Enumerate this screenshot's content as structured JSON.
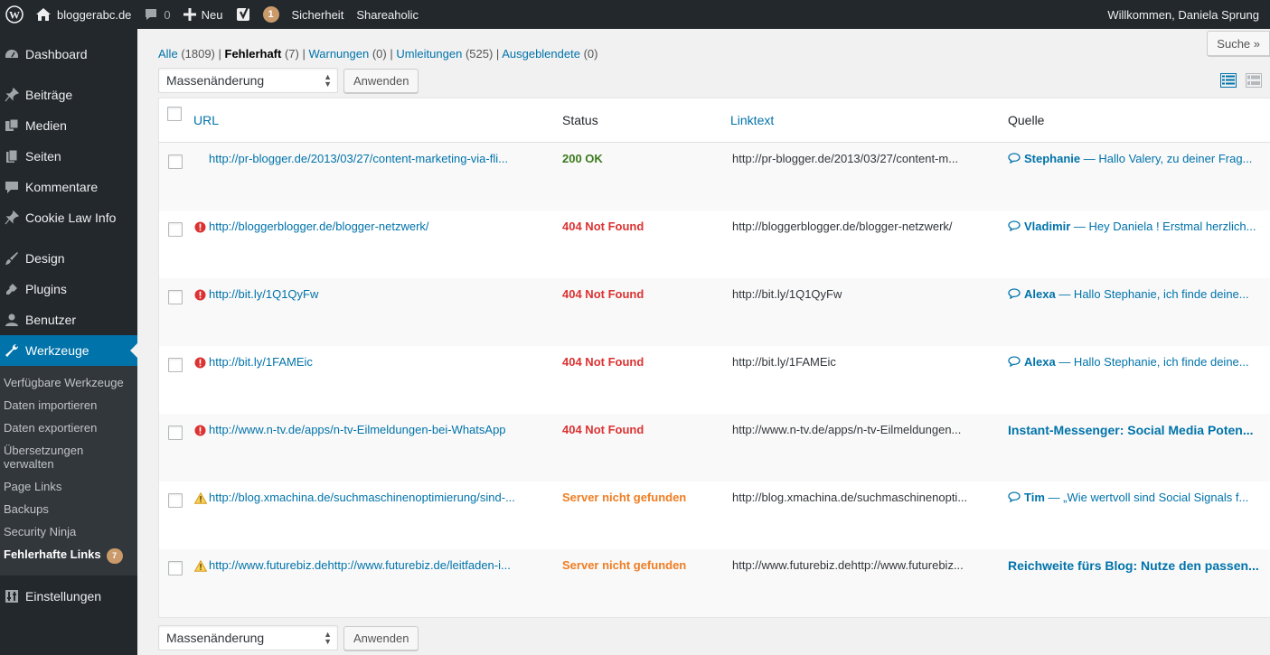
{
  "adminbar": {
    "site_name": "bloggerabc.de",
    "comments_count": "0",
    "new_label": "Neu",
    "yoast_count": "1",
    "security_label": "Sicherheit",
    "shareaholic_label": "Shareaholic",
    "welcome": "Willkommen, Daniela Sprung"
  },
  "sidebar": {
    "items": [
      {
        "label": "Dashboard",
        "icon": "dashboard-icon"
      },
      {
        "label": "Beiträge",
        "icon": "pin-icon"
      },
      {
        "label": "Medien",
        "icon": "media-icon"
      },
      {
        "label": "Seiten",
        "icon": "pages-icon"
      },
      {
        "label": "Kommentare",
        "icon": "comment-icon"
      },
      {
        "label": "Cookie Law Info",
        "icon": "pin-icon"
      },
      {
        "label": "Design",
        "icon": "brush-icon"
      },
      {
        "label": "Plugins",
        "icon": "plugin-icon"
      },
      {
        "label": "Benutzer",
        "icon": "user-icon"
      },
      {
        "label": "Werkzeuge",
        "icon": "wrench-icon"
      },
      {
        "label": "Einstellungen",
        "icon": "settings-icon"
      }
    ],
    "submenu": [
      "Verfügbare Werkzeuge",
      "Daten importieren",
      "Daten exportieren",
      "Übersetzungen verwalten",
      "Page Links",
      "Backups",
      "Security Ninja",
      "Fehlerhafte Links"
    ],
    "submenu_badge": "7"
  },
  "main": {
    "search_button": "Suche »",
    "filters": {
      "all_label": "Alle",
      "all_count": "(1809)",
      "broken_label": "Fehlerhaft",
      "broken_count": "(7)",
      "warnings_label": "Warnungen",
      "warnings_count": "(0)",
      "redirects_label": "Umleitungen",
      "redirects_count": "(525)",
      "hidden_label": "Ausgeblendete",
      "hidden_count": "(0)"
    },
    "bulk_select": "Massenänderung",
    "apply_button": "Anwenden",
    "columns": {
      "url": "URL",
      "status": "Status",
      "linktext": "Linktext",
      "source": "Quelle"
    },
    "rows": [
      {
        "url": "http://pr-blogger.de/2013/03/27/content-marketing-via-fli...",
        "status": "200 OK",
        "status_type": "ok",
        "linktext": "http://pr-blogger.de/2013/03/27/content-m...",
        "source_author": "Stephanie",
        "source_text": " — Hallo Valery, zu deiner Frag...",
        "source_type": "comment"
      },
      {
        "url": "http://bloggerblogger.de/blogger-netzwerk/",
        "status": "404 Not Found",
        "status_type": "error",
        "linktext": "http://bloggerblogger.de/blogger-netzwerk/",
        "source_author": "Vladimir",
        "source_text": " — Hey Daniela ! Erstmal herzlich...",
        "source_type": "comment"
      },
      {
        "url": "http://bit.ly/1Q1QyFw",
        "status": "404 Not Found",
        "status_type": "error",
        "linktext": "http://bit.ly/1Q1QyFw",
        "source_author": "Alexa",
        "source_text": " — Hallo Stephanie, ich finde deine...",
        "source_type": "comment"
      },
      {
        "url": "http://bit.ly/1FAMEic",
        "status": "404 Not Found",
        "status_type": "error",
        "linktext": "http://bit.ly/1FAMEic",
        "source_author": "Alexa",
        "source_text": " — Hallo Stephanie, ich finde deine...",
        "source_type": "comment"
      },
      {
        "url": "http://www.n-tv.de/apps/n-tv-Eilmeldungen-bei-WhatsApp",
        "status": "404 Not Found",
        "status_type": "error",
        "linktext": "http://www.n-tv.de/apps/n-tv-Eilmeldungen...",
        "source_author": "",
        "source_text": "Instant-Messenger: Social Media Poten...",
        "source_type": "post"
      },
      {
        "url": "http://blog.xmachina.de/suchmaschinenoptimierung/sind-...",
        "status": "Server nicht gefunden",
        "status_type": "warn",
        "linktext": "http://blog.xmachina.de/suchmaschinenopti...",
        "source_author": "Tim",
        "source_text": " — „Wie wertvoll sind Social Signals f...",
        "source_type": "comment"
      },
      {
        "url": "http://www.futurebiz.dehttp://www.futurebiz.de/leitfaden-i...",
        "status": "Server nicht gefunden",
        "status_type": "warn",
        "linktext": "http://www.futurebiz.dehttp://www.futurebiz...",
        "source_author": "",
        "source_text": "Reichweite fürs Blog: Nutze den passen...",
        "source_type": "post"
      }
    ]
  },
  "colors": {
    "adminbar_bg": "#23282d",
    "accent": "#0073aa",
    "ok": "#3c7a1e",
    "error": "#dc3232",
    "warning": "#f07d22"
  }
}
